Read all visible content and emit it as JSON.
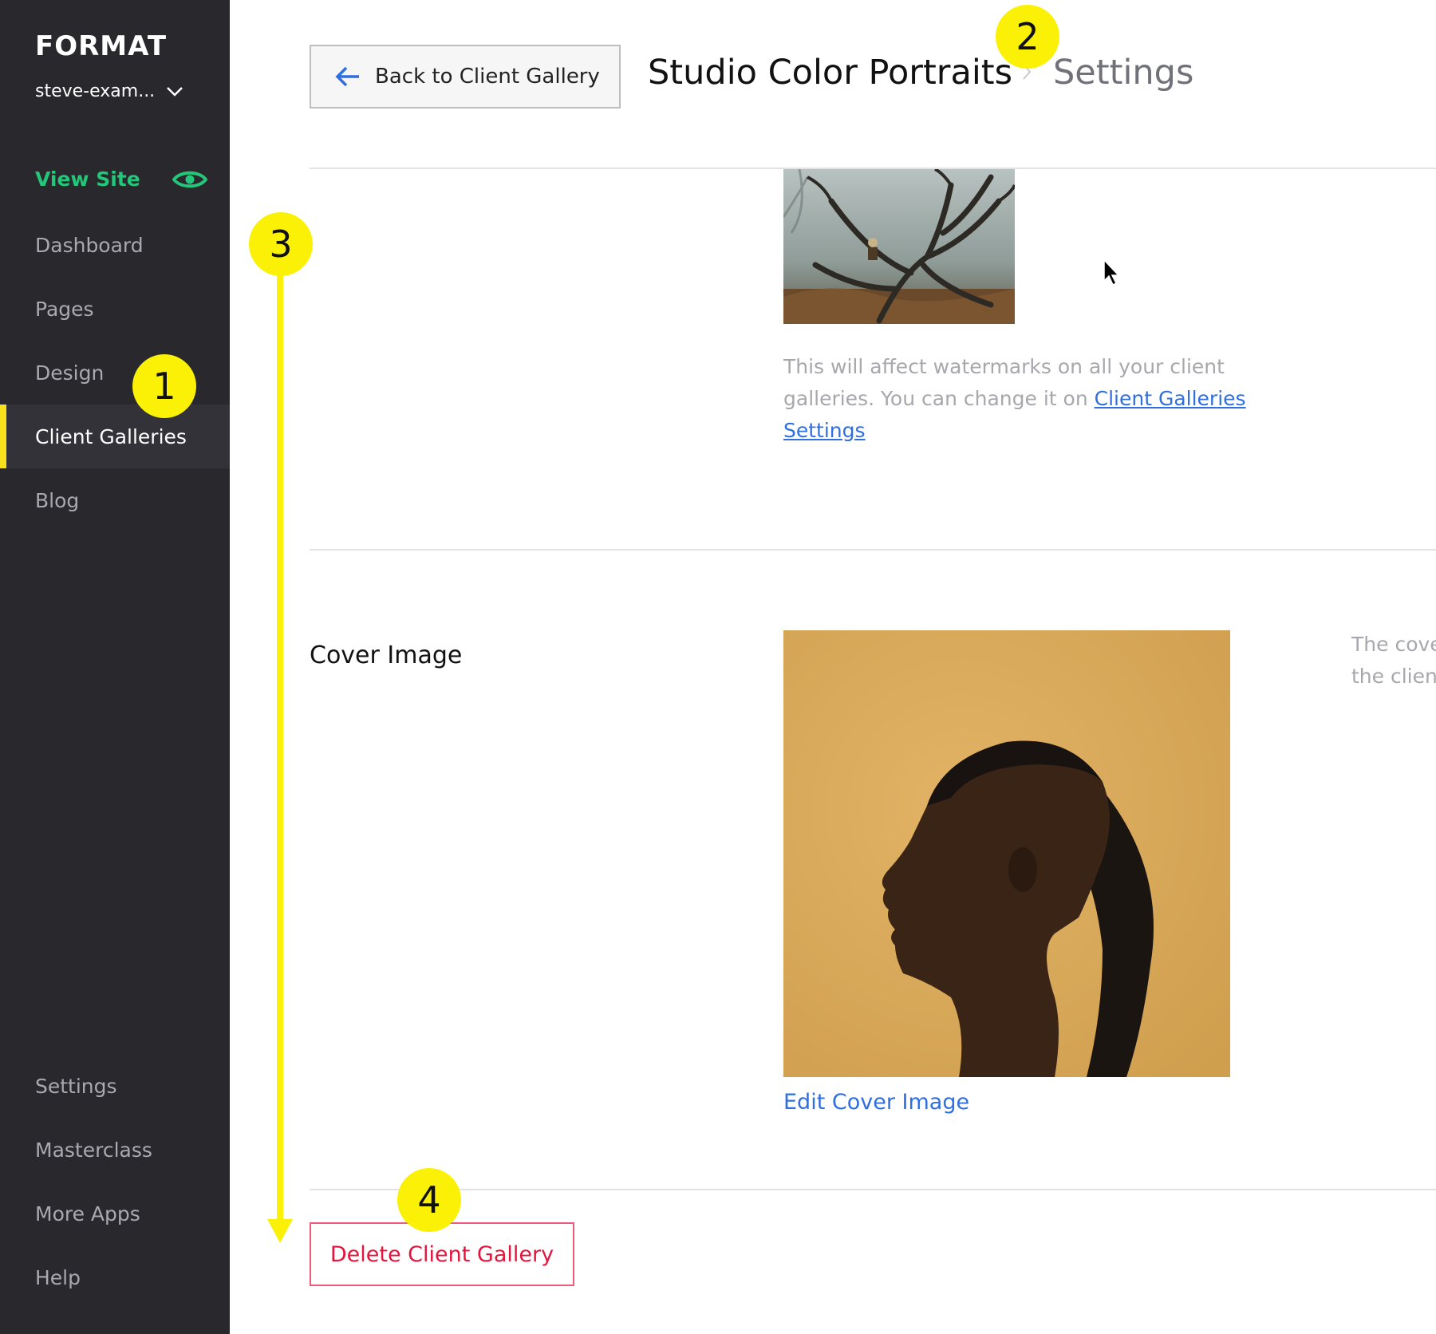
{
  "app": {
    "logo": "FORMAT",
    "site_selector": "steve-exam..."
  },
  "sidebar": {
    "view_site": "View Site",
    "items": [
      {
        "label": "Dashboard"
      },
      {
        "label": "Pages"
      },
      {
        "label": "Design"
      },
      {
        "label": "Client Galleries",
        "active": true
      },
      {
        "label": "Blog"
      }
    ],
    "bottom_items": [
      {
        "label": "Settings"
      },
      {
        "label": "Masterclass"
      },
      {
        "label": "More Apps"
      },
      {
        "label": "Help"
      }
    ]
  },
  "header": {
    "back_label": "Back to Client Gallery",
    "gallery_title": "Studio Color Portraits",
    "current_page": "Settings"
  },
  "watermark": {
    "description": "This will affect watermarks on all your client galleries. You can change it on ",
    "link_label": "Client Galleries Settings"
  },
  "cover": {
    "label": "Cover Image",
    "edit_label": "Edit Cover Image",
    "description_line1": "The cove",
    "description_line2": "the client"
  },
  "actions": {
    "delete_label": "Delete Client Gallery"
  },
  "annotations": {
    "badges": [
      "1",
      "2",
      "3",
      "4"
    ]
  },
  "colors": {
    "sidebar_bg": "#28282d",
    "accent_green": "#24c67a",
    "highlight_yellow": "#fbf107",
    "link_blue": "#2f6fe0",
    "danger_red": "#e5143c"
  }
}
